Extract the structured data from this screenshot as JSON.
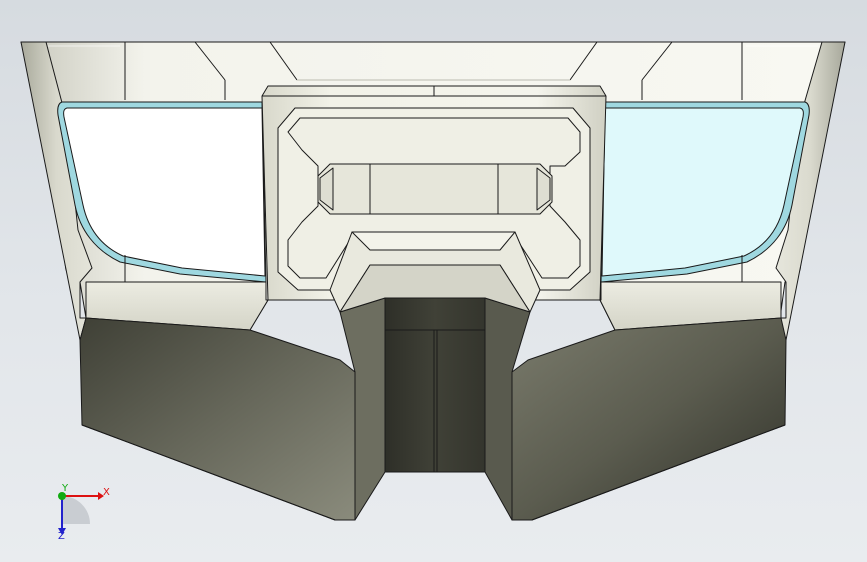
{
  "viewport": {
    "background_top": "#d8dde2",
    "background_bottom": "#e9ecef",
    "background_mid": "#dfe3e7"
  },
  "model": {
    "edge_color": "#1a1a1a",
    "glass_color": "#9fd8e0",
    "glass_fill_left": "#ffffff",
    "glass_fill_right": "#dff9fb",
    "body_light": "#efefe6",
    "body_dark": "#5f604f"
  },
  "triad": {
    "x_label": "X",
    "y_label": "Y",
    "z_label": "Z",
    "x_color": "#dd1111",
    "y_color": "#11aa11",
    "z_color": "#2222cc"
  }
}
